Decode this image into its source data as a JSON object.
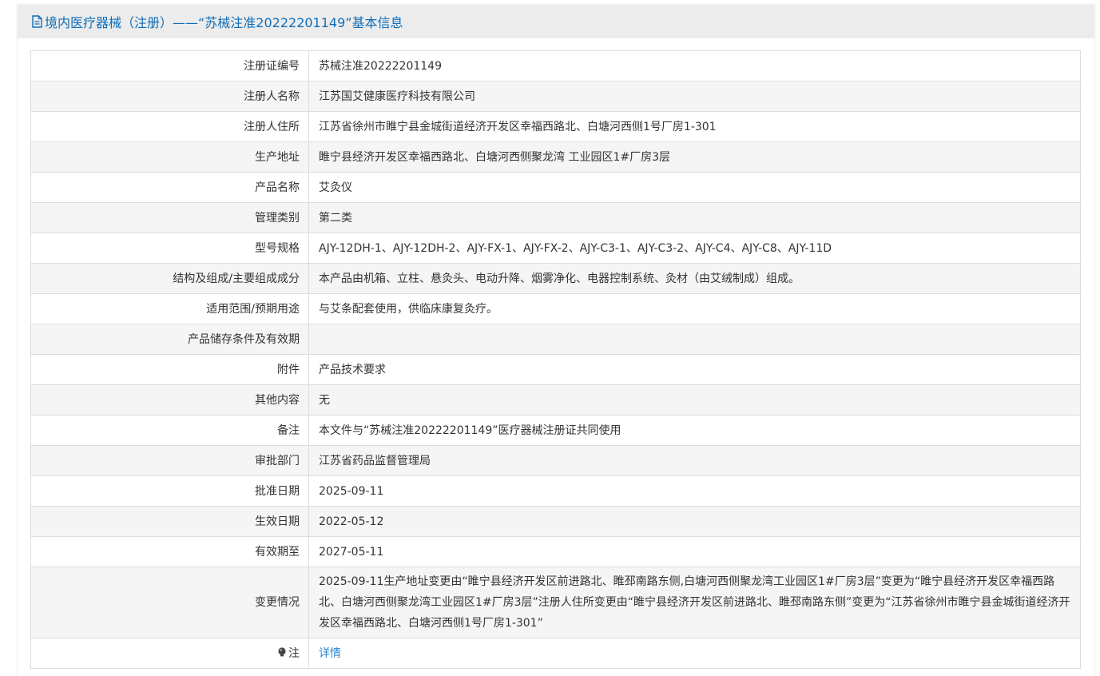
{
  "header": {
    "title": "境内医疗器械（注册）——“苏械注准20222201149”基本信息"
  },
  "rows": [
    {
      "label": "注册证编号",
      "value": "苏械注准20222201149"
    },
    {
      "label": "注册人名称",
      "value": "江苏国艾健康医疗科技有限公司"
    },
    {
      "label": "注册人住所",
      "value": "江苏省徐州市睢宁县金城街道经济开发区幸福西路北、白塘河西侧1号厂房1-301"
    },
    {
      "label": "生产地址",
      "value": "睢宁县经济开发区幸福西路北、白塘河西侧聚龙湾 工业园区1#厂房3层"
    },
    {
      "label": "产品名称",
      "value": "艾灸仪"
    },
    {
      "label": "管理类别",
      "value": "第二类"
    },
    {
      "label": "型号规格",
      "value": "AJY-12DH-1、AJY-12DH-2、AJY-FX-1、AJY-FX-2、AJY-C3-1、AJY-C3-2、AJY-C4、AJY-C8、AJY-11D"
    },
    {
      "label": "结构及组成/主要组成成分",
      "value": "本产品由机箱、立柱、悬灸头、电动升降、烟雾净化、电器控制系统、灸材（由艾绒制成）组成。"
    },
    {
      "label": "适用范围/预期用途",
      "value": "与艾条配套使用，供临床康复灸疗。"
    },
    {
      "label": "产品储存条件及有效期",
      "value": ""
    },
    {
      "label": "附件",
      "value": "产品技术要求"
    },
    {
      "label": "其他内容",
      "value": "无"
    },
    {
      "label": "备注",
      "value": "本文件与“苏械注准20222201149”医疗器械注册证共同使用"
    },
    {
      "label": "审批部门",
      "value": "江苏省药品监督管理局"
    },
    {
      "label": "批准日期",
      "value": "2025-09-11"
    },
    {
      "label": "生效日期",
      "value": "2022-05-12"
    },
    {
      "label": "有效期至",
      "value": "2027-05-11"
    },
    {
      "label": "变更情况",
      "value": "2025-09-11生产地址变更由“睢宁县经济开发区前进路北、睢邳南路东侧,白塘河西侧聚龙湾工业园区1#厂房3层”变更为“睢宁县经济开发区幸福西路北、白塘河西侧聚龙湾工业园区1#厂房3层”注册人住所变更由“睢宁县经济开发区前进路北、睢邳南路东侧”变更为“江苏省徐州市睢宁县金城街道经济开发区幸福西路北、白塘河西侧1号厂房1-301”"
    }
  ],
  "note": {
    "icon": "lightbulb-icon",
    "label": "注",
    "link": "详情"
  },
  "colors": {
    "title": "#0e6eb8",
    "link": "#2a84d3",
    "header_bg": "#ececec",
    "row_alt": "#f5f5f5",
    "border": "#dddddd"
  }
}
